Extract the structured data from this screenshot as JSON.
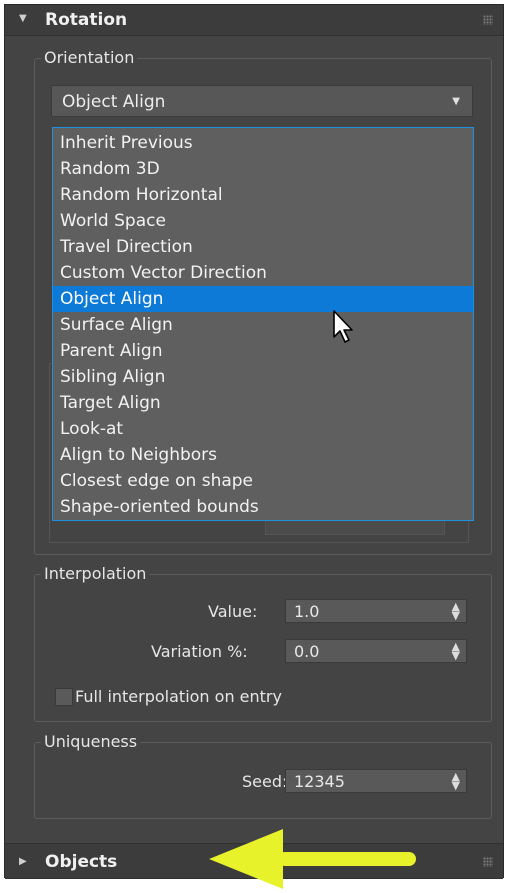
{
  "rotation": {
    "title": "Rotation",
    "orientation": {
      "label": "Orientation",
      "selected": "Object Align",
      "options": [
        "Inherit Previous",
        "Random 3D",
        "Random Horizontal",
        "World Space",
        "Travel Direction",
        "Custom Vector Direction",
        "Object Align",
        "Surface Align",
        "Parent Align",
        "Sibling Align",
        "Target Align",
        "Look-at",
        "Align to Neighbors",
        "Closest edge on shape",
        "Shape-oriented bounds"
      ]
    },
    "interpolation": {
      "label": "Interpolation",
      "value_label": "Value:",
      "value": "1.0",
      "variation_label": "Variation %:",
      "variation": "0.0",
      "full_interpolation_label": "Full interpolation on entry"
    },
    "uniqueness": {
      "label": "Uniqueness",
      "seed_label": "Seed:",
      "seed": "12345"
    }
  },
  "objects": {
    "title": "Objects"
  },
  "annotation": {
    "arrow_color": "#e8f22a"
  },
  "colors": {
    "panel": "#444444",
    "selection": "#0d7ad8",
    "list_border": "#1e90e0"
  }
}
